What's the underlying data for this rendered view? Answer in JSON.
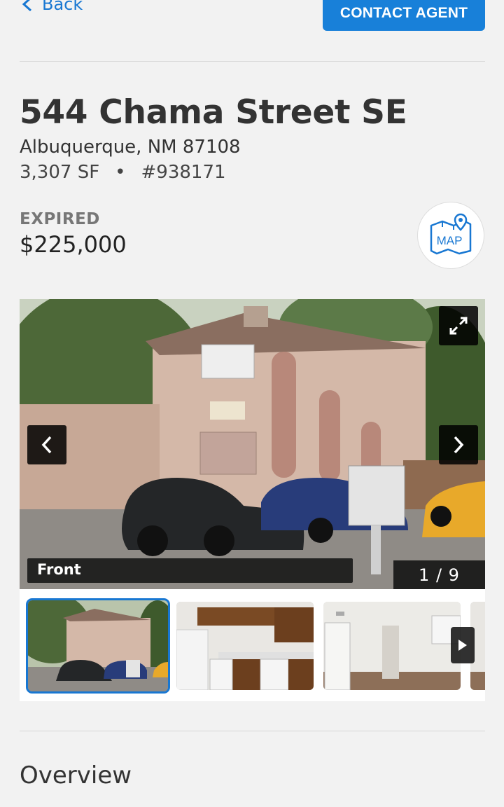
{
  "header": {
    "back_label": "Back",
    "contact_label": "CONTACT AGENT"
  },
  "listing": {
    "title": "544 Chama Street SE",
    "address": "Albuquerque, NM 87108",
    "size": "3,307 SF",
    "separator": "•",
    "listing_id": "#938171",
    "status": "EXPIRED",
    "price": "$225,000"
  },
  "map_button": {
    "label": "MAP",
    "icon": "map-pin-icon"
  },
  "gallery": {
    "caption": "Front",
    "counter": "1 / 9",
    "thumbnails": [
      {
        "name": "front",
        "active": true
      },
      {
        "name": "kitchen",
        "active": false
      },
      {
        "name": "bedroom",
        "active": false
      },
      {
        "name": "partial",
        "active": false
      }
    ]
  },
  "sections": {
    "overview_title": "Overview"
  },
  "colors": {
    "accent": "#1880d9",
    "background": "#f2f2f2"
  }
}
